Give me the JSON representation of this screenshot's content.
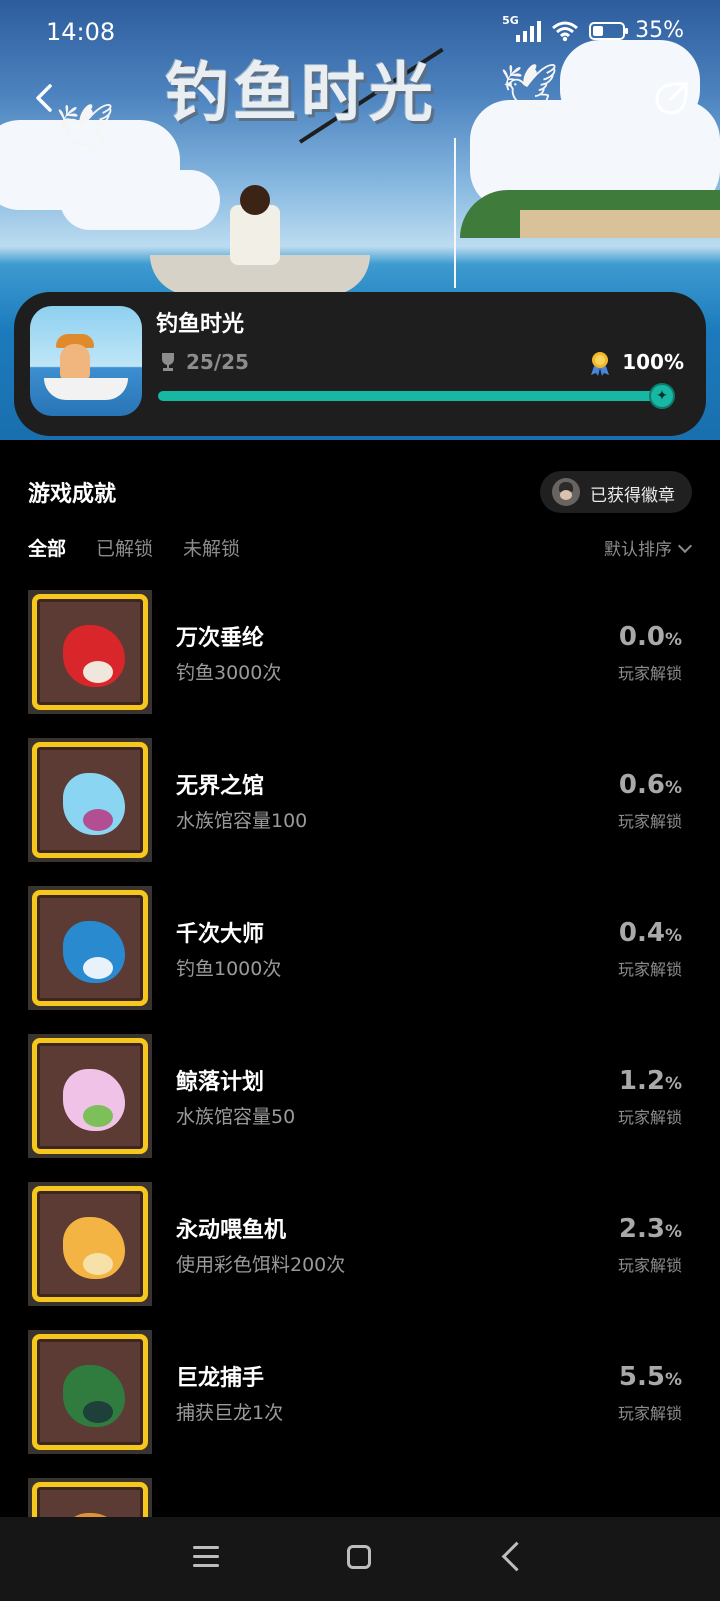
{
  "status_bar": {
    "time": "14:08",
    "network": "5G",
    "battery": "35%"
  },
  "hero": {
    "title": "钓鱼时光"
  },
  "game": {
    "title": "钓鱼时光",
    "achievement_count": "25/25",
    "completion": "100%",
    "progress_fraction": 1.0,
    "accent_color": "#16b8a3"
  },
  "section": {
    "title": "游戏成就",
    "badge_button": "已获得徽章"
  },
  "tabs": [
    {
      "label": "全部",
      "active": true
    },
    {
      "label": "已解锁",
      "active": false
    },
    {
      "label": "未解锁",
      "active": false
    }
  ],
  "sort": {
    "label": "默认排序"
  },
  "achievements": [
    {
      "name": "万次垂纶",
      "desc": "钓鱼3000次",
      "rate": "0.0",
      "unit": "%",
      "rate_label": "玩家解锁",
      "icon": "red-koi-fish-icon",
      "color": "#d8262a",
      "color2": "#f1e6dc"
    },
    {
      "name": "无界之馆",
      "desc": "水族馆容量100",
      "rate": "0.6",
      "unit": "%",
      "rate_label": "玩家解锁",
      "icon": "crystal-fish-icon",
      "color": "#8ad6f2",
      "color2": "#b24f93"
    },
    {
      "name": "千次大师",
      "desc": "钓鱼1000次",
      "rate": "0.4",
      "unit": "%",
      "rate_label": "玩家解锁",
      "icon": "blue-fish-icon",
      "color": "#2a8ad0",
      "color2": "#e8f2fa"
    },
    {
      "name": "鲸落计划",
      "desc": "水族馆容量50",
      "rate": "1.2",
      "unit": "%",
      "rate_label": "玩家解锁",
      "icon": "pink-fish-icon",
      "color": "#f1c2e8",
      "color2": "#7dbf58"
    },
    {
      "name": "永动喂鱼机",
      "desc": "使用彩色饵料200次",
      "rate": "2.3",
      "unit": "%",
      "rate_label": "玩家解锁",
      "icon": "golden-fish-icon",
      "color": "#f3b443",
      "color2": "#f6e2a8"
    },
    {
      "name": "巨龙捕手",
      "desc": "捕获巨龙1次",
      "rate": "5.5",
      "unit": "%",
      "rate_label": "玩家解锁",
      "icon": "dragon-head-icon",
      "color": "#2f7c3e",
      "color2": "#1e3f3a"
    },
    {
      "name": "",
      "desc": "",
      "rate": "",
      "unit": "",
      "rate_label": "",
      "icon": "partial-item-icon",
      "color": "#e0923a",
      "color2": "#c05a2a"
    }
  ]
}
